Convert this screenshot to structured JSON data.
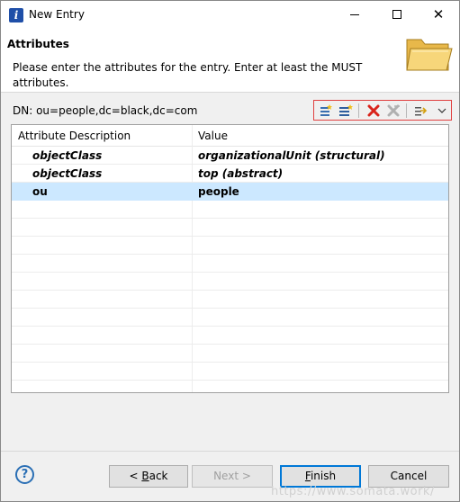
{
  "window": {
    "title": "New Entry",
    "app_icon": "eclipse-app-icon",
    "minimize": "minimize-icon",
    "maximize": "maximize-icon",
    "close": "✕"
  },
  "header": {
    "title": "Attributes",
    "description": "Please enter the attributes for the entry. Enter at least the MUST attributes.",
    "icon": "folder-icon"
  },
  "dn": {
    "label": "DN: ou=people,dc=black,dc=com"
  },
  "toolbar": {
    "items": [
      "new-value-icon",
      "new-attribute-icon",
      "delete-icon",
      "delete-all-icon",
      "expand-icon",
      "menu-dropdown-icon"
    ]
  },
  "table": {
    "columns": [
      "Attribute Description",
      "Value"
    ],
    "rows": [
      {
        "attribute": "objectClass",
        "value": "organizationalUnit (structural)",
        "style": "italic-bold"
      },
      {
        "attribute": "objectClass",
        "value": "top (abstract)",
        "style": "italic-bold"
      },
      {
        "attribute": "ou",
        "value": "people",
        "style": "bold",
        "selected": true
      }
    ]
  },
  "footer": {
    "help": "?",
    "back_prefix": "< ",
    "back_mnemonic": "B",
    "back_rest": "ack",
    "next": "Next >",
    "finish_mnemonic": "F",
    "finish_rest": "inish",
    "cancel": "Cancel"
  },
  "watermark": "https://www.somata.work/",
  "colors": {
    "selection": "#cce8ff",
    "default_button_border": "#0078d7",
    "toolbar_highlight_border": "#e04040",
    "delete_red": "#d9231b"
  }
}
